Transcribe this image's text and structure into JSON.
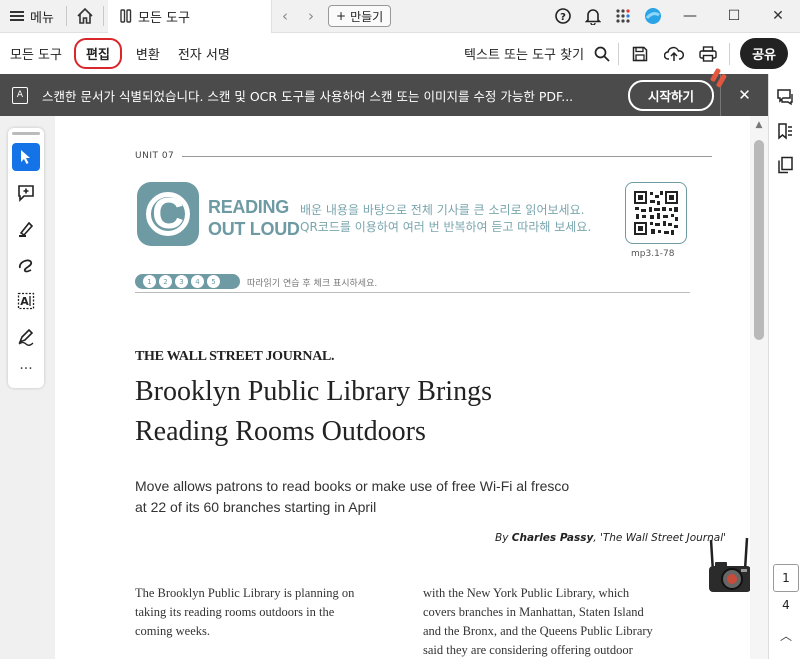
{
  "titlebar": {
    "menu_label": "메뉴",
    "tab_label": "모든 도구",
    "new_label": "만들기"
  },
  "menubar": {
    "items": [
      "모든 도구",
      "편집",
      "변환",
      "전자 서명"
    ],
    "active": "편집",
    "find_label": "텍스트 또는 도구 찾기",
    "share_label": "공유"
  },
  "banner": {
    "text": "스캔한 문서가 식별되었습니다. 스캔 및 OCR 도구를 사용하여 스캔 또는 이미지를 수정 가능한 PDF...",
    "start_label": "시작하기"
  },
  "pagenav": {
    "current": "1",
    "total": "4"
  },
  "document": {
    "unit": "UNIT 07",
    "badge_letter": "C",
    "reading": "READING",
    "out_loud": "OUT LOUD",
    "desc_line1": "배운 내용을 바탕으로 전체 기사를 큰 소리로 읽어보세요.",
    "desc_line2": "QR코드를 이용하여 여러 번 반복하여 듣고 따라해 보세요.",
    "qr_label": "mp3.1-78",
    "checks": [
      "1",
      "2",
      "3",
      "4",
      "5"
    ],
    "ribbon_text": "따라읽기 연습 후 체크 표시하세요.",
    "masthead": "THE WALL STREET JOURNAL.",
    "headline_line1": "Brooklyn Public Library Brings",
    "headline_line2": "Reading Rooms Outdoors",
    "subhead_line1": "Move allows patrons to read books or make use of free Wi-Fi al fresco",
    "subhead_line2": "at 22 of its 60 branches starting in April",
    "byline_prefix": "By ",
    "byline_author": "Charles Passy",
    "byline_source": ", 'The Wall Street Journal'",
    "col1": [
      "The Brooklyn Public Library is planning on",
      "taking its reading rooms outdoors in the",
      "coming weeks."
    ],
    "col2": [
      "with the New York Public Library, which",
      "covers branches in Manhattan, Staten Island",
      "and the Bronx, and the Queens Public Library",
      "said they are considering offering outdoor"
    ]
  },
  "colors": {
    "accent": "#1473e6",
    "badge": "#6e9aa3",
    "highlight_circle": "#d9262b",
    "banner_bg": "#4b4b4b"
  }
}
